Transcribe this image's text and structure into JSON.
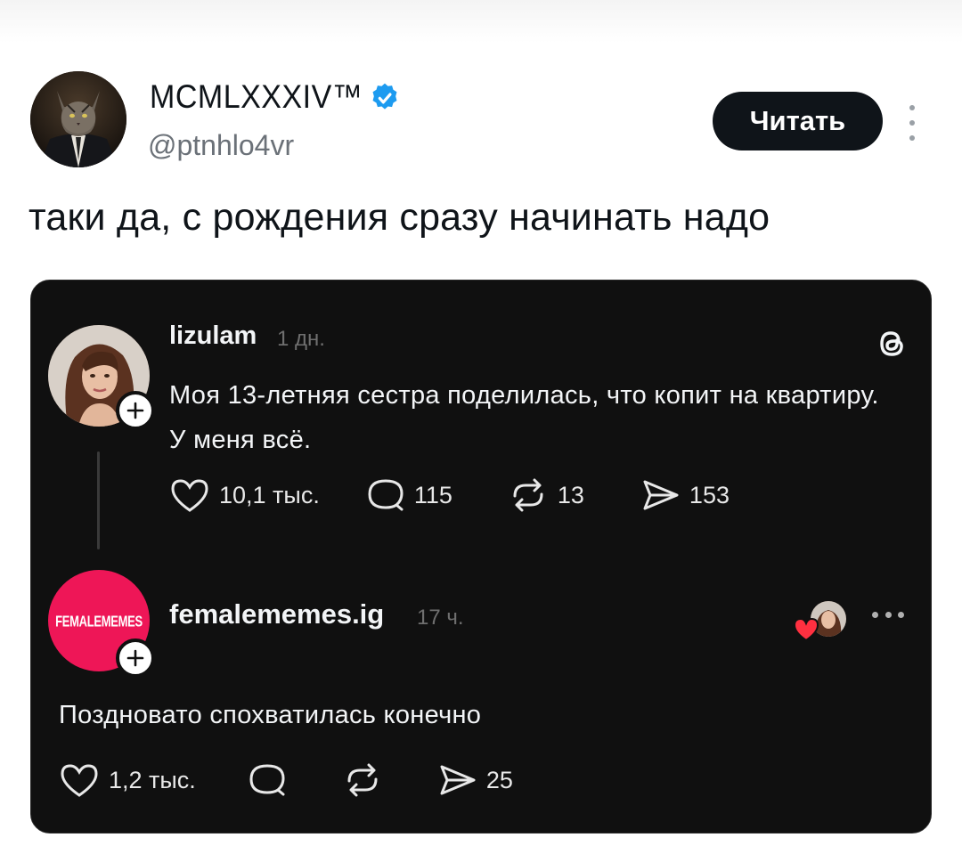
{
  "author": {
    "name": "MCMLXXXIV™",
    "handle": "@ptnhlo4vr",
    "verified": true,
    "verified_color": "#1d9bf0",
    "avatar_icon": "cat-in-suit-avatar"
  },
  "follow_button": {
    "label": "Читать"
  },
  "tweet": {
    "text": "таки да, с рождения сразу начинать надо"
  },
  "embedded_post": {
    "platform_icon": "threads-icon",
    "post1": {
      "username": "lizulam",
      "time": "1 дн.",
      "text": "Моя 13-летняя сестра поделилась, что копит на квартиру. У меня всё.",
      "likes": "10,1 тыс.",
      "comments": "115",
      "reposts": "13",
      "shares": "153"
    },
    "post2": {
      "username": "femalememes.ig",
      "time": "17 ч.",
      "avatar_text": "FEMALEMEMES",
      "avatar_color": "#ee1657",
      "text": "Поздновато спохватилась конечно",
      "likes": "1,2 тыс.",
      "shares": "25"
    }
  }
}
